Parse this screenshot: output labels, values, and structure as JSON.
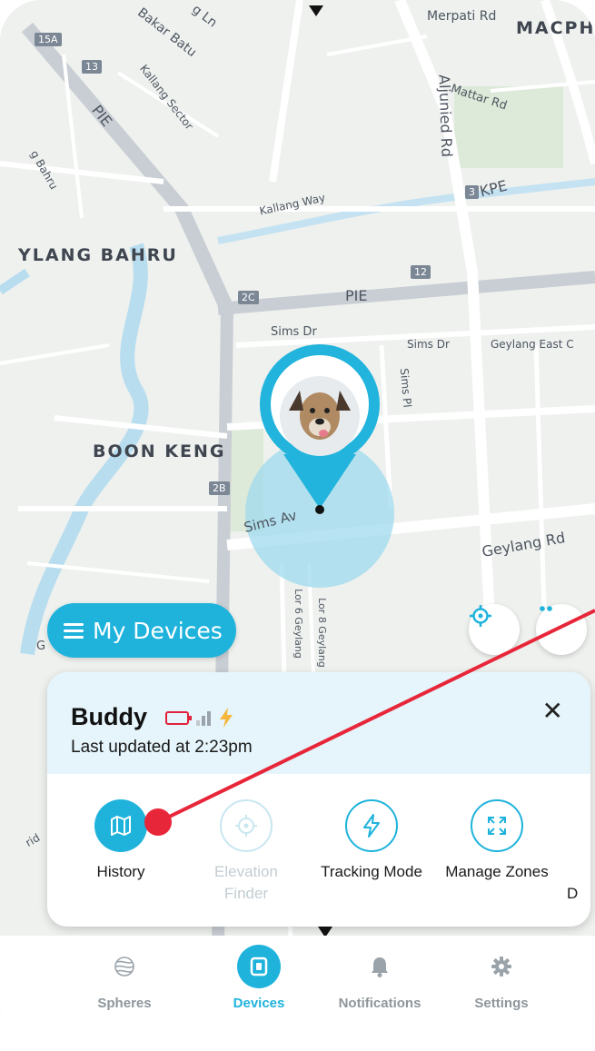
{
  "map": {
    "labels": {
      "merpati_rd": "Merpati Rd",
      "macph": "MACPH",
      "bakar_batu": "Bakar Batu",
      "ln": "g Ln",
      "pie_1": "PIE",
      "kallang_sector": "Kallang Sector",
      "bahru_small": "g Bahru",
      "aljunied_rd": "Aljunied Rd",
      "mattar_rd": "Mattar Rd",
      "kallang_way": "Kallang Way",
      "kpe": "KPE",
      "ylang_bahru": "YLANG BAHRU",
      "pie_2": "PIE",
      "sims_dr_1": "Sims Dr",
      "sims_dr_2": "Sims Dr",
      "geylang_east": "Geylang East C",
      "sims_pl": "Sims Pl",
      "boon_keng": "BOON KENG",
      "sims_av": "Sims Av",
      "geylang_rd": "Geylang Rd",
      "lor8": "Lor 8 Geylang",
      "lor6": "Lor 6 Geylang",
      "g_left": "G",
      "rid": "rid"
    },
    "shields": {
      "s15a": "15A",
      "s13": "13",
      "s3": "3",
      "s12": "12",
      "s2c": "2C",
      "s2b": "2B"
    }
  },
  "my_devices_label": "My Devices",
  "device": {
    "name": "Buddy",
    "last_updated": "Last updated at 2:23pm",
    "battery_color": "#e2213a",
    "charging_color": "#f6b73c"
  },
  "actions": [
    {
      "label": "History",
      "icon": "map-icon",
      "state": "active"
    },
    {
      "label": "Elevation Finder",
      "icon": "crosshair-icon",
      "state": "disabled"
    },
    {
      "label": "Tracking Mode",
      "icon": "lightning-icon",
      "state": "normal"
    },
    {
      "label": "Manage Zones",
      "icon": "expand-icon",
      "state": "normal"
    },
    {
      "label": "D",
      "icon": "",
      "state": "normal"
    }
  ],
  "tabs": [
    {
      "label": "Spheres",
      "icon": "spheres-icon",
      "active": false
    },
    {
      "label": "Devices",
      "icon": "device-icon",
      "active": true
    },
    {
      "label": "Notifications",
      "icon": "bell-icon",
      "active": false
    },
    {
      "label": "Settings",
      "icon": "gear-icon",
      "active": false
    }
  ],
  "colors": {
    "accent": "#1fb3dc",
    "annotation": "#e8263a"
  }
}
